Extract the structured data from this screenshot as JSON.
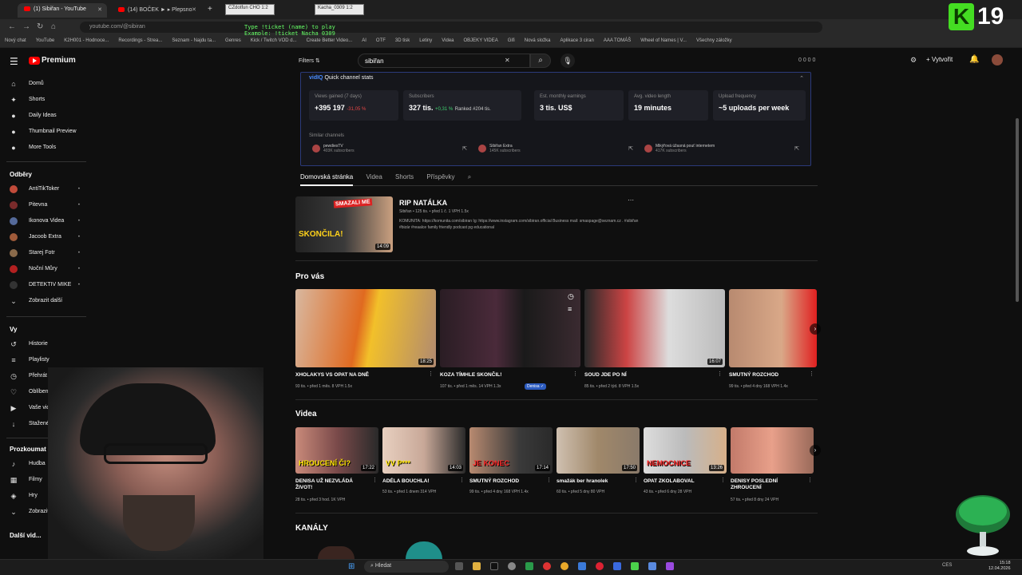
{
  "browser": {
    "tabs": [
      {
        "label": "(1) Sibiřan - YouTube"
      },
      {
        "label": "(14) BOČEK ► ▸ Plepsno"
      }
    ],
    "url": "youtube.com/@sibiran",
    "bookmarks": [
      "Nový chat",
      "YouTube",
      "K2H001 - Hodnoce...",
      "Recordings - Strea...",
      "Seznam - Najdu ta...",
      "Genres",
      "Kick / Twitch VOD d...",
      "Create Better Video...",
      "AI",
      "OTF",
      "3D tisk",
      "Letiny",
      "Videa",
      "OBJEKY VIDEA",
      "Gifi",
      "Nová složka",
      "Aplikace 3 ciran",
      "AAA TOMÁŠ",
      "Wheel of Names | V...",
      "Všechny záložky"
    ],
    "overlay_lines": [
      "Type !ticket (name) to play",
      "Example: !ticket Nacha 0309"
    ],
    "mini_tabs": [
      "CZdotfun CHO 1:2",
      "Kacha_0309 1:2"
    ]
  },
  "brand": {
    "k": "K",
    "num": "19"
  },
  "header": {
    "logo_text": "Premium",
    "filters_label": "Filters",
    "search_value": "sibiřan",
    "create_label": "Vytvořit",
    "counters": "0 0 0 0"
  },
  "sidebar": {
    "main": [
      {
        "label": "Domů",
        "icon": "home-icon",
        "glyph": "⌂"
      },
      {
        "label": "Shorts",
        "icon": "shorts-icon",
        "glyph": "✦"
      },
      {
        "label": "Daily Ideas",
        "icon": "ideas-icon",
        "glyph": "●"
      },
      {
        "label": "Thumbnail Preview",
        "icon": "thumbnail-icon",
        "glyph": "●"
      },
      {
        "label": "More Tools",
        "icon": "tools-icon",
        "glyph": "●"
      }
    ],
    "subs_head": "Odběry",
    "subs": [
      {
        "label": "AntiTikToker",
        "color": "#c14b3a"
      },
      {
        "label": "Pitevna",
        "color": "#7a2b2b"
      },
      {
        "label": "Ikonova Videa",
        "color": "#556a9a"
      },
      {
        "label": "Jacoob Extra",
        "color": "#a05b3a"
      },
      {
        "label": "Starej Fotr",
        "color": "#8a6a4a"
      },
      {
        "label": "Noční Můry",
        "color": "#b32020"
      },
      {
        "label": "DETEKTIV MIKE",
        "color": "#333333"
      }
    ],
    "show_more": "Zobrazit další",
    "you_head": "Vy",
    "you": [
      {
        "label": "Historie",
        "glyph": "↺"
      },
      {
        "label": "Playlisty",
        "glyph": "≡"
      },
      {
        "label": "Přehrát později",
        "glyph": "◷"
      },
      {
        "label": "Oblíbená videa",
        "glyph": "♡"
      },
      {
        "label": "Vaše videa",
        "glyph": "▶"
      },
      {
        "label": "Stažené",
        "glyph": "↓"
      }
    ],
    "explore_head": "Prozkoumat",
    "explore": [
      {
        "label": "Hudba",
        "glyph": "♪"
      },
      {
        "label": "Filmy",
        "glyph": "▦"
      },
      {
        "label": "Hry",
        "glyph": "◈"
      }
    ],
    "explore_more": "Zobrazit další",
    "other_head": "Další vid..."
  },
  "vidiq": {
    "brand": "vidIQ",
    "title": "Quick channel stats",
    "stats": [
      {
        "label": "Views gained (7 days)",
        "value": "+395 197",
        "delta": "-31,05 %",
        "dir": "down"
      },
      {
        "label": "Subscribers",
        "value": "327 tis.",
        "delta": "+0,31 %",
        "dir": "up",
        "rank": "Ranked #204 tis."
      },
      {
        "label": "Est. monthly earnings",
        "value": "3 tis. US$"
      },
      {
        "label": "Avg. video length",
        "value": "19 minutes"
      },
      {
        "label": "Upload frequency",
        "value": "~5 uploads per week"
      }
    ],
    "similar_label": "Similar channels",
    "similar": [
      {
        "name": "pewdiesTV",
        "subs": "403K subscribers"
      },
      {
        "name": "Sibiřan Extra",
        "subs": "145K subscribers"
      },
      {
        "name": "Mikýřová úžasná pouť internetem",
        "subs": "417K subscribers"
      }
    ]
  },
  "channel_tabs": [
    "Domovská stránka",
    "Videa",
    "Shorts",
    "Příspěvky"
  ],
  "featured": {
    "title": "RIP NATÁLKA",
    "meta": "Sibiřan  •  125 tis.  •  před 1 č.  1 VPH  1.5x",
    "desc": "KOMUNITA: https://komunita.com/sibiran Ig: https://www.instagram.com/sibiran.official Business mail: smaspage@seznam.cz . #sibiřan #bizár #reaalce family friendly podcast pg educational",
    "duration": "14:09",
    "thumb_text": [
      "SMAZALI ME",
      "SKONČILA!"
    ]
  },
  "pro_vas": {
    "heading": "Pro vás",
    "videos": [
      {
        "title": "XHOLAKYS VS OPAT NA DNĚ",
        "meta": "93 tis. • před 1 měs.  8 VPH  1.5x",
        "duration": "18:25"
      },
      {
        "title": "KOZA TÍMHLE SKONČIL!",
        "meta": "107 tis. • před 1 měs.  14 VPH  1.3x",
        "badge": "Denisa ✓",
        "duration": ""
      },
      {
        "title": "SOUD JDE PO NÍ",
        "meta": "85 tis. • před 2 týd.  8 VPH  1.5x",
        "duration": "16:07"
      },
      {
        "title": "SMUTNÝ ROZCHOD",
        "meta": "99 tis. • před 4 dny  168 VPH  1.4x",
        "duration": ""
      }
    ]
  },
  "videa": {
    "heading": "Videa",
    "videos": [
      {
        "title": "DENISA UŽ NEZVLÁDÁ ŽIVOT!",
        "meta": "28 tis. • před 3 hod.  1K VPH",
        "duration": "17:22",
        "thumb_text": "HROUCENÍ ČI?"
      },
      {
        "title": "ADÉLA BOUCHLA!",
        "meta": "53 tis. • před 1 dnem  314 VPH",
        "duration": "14:03",
        "thumb_text": "VV P***"
      },
      {
        "title": "SMUTNÝ ROZCHOD",
        "meta": "99 tis. • před 4 dny  168 VPH  1.4x",
        "duration": "17:14",
        "thumb_text": "JE KONEC"
      },
      {
        "title": "smažák ber hranolek",
        "meta": "60 tis. • před 5 dny  80 VPH",
        "duration": "17:50",
        "thumb_text": ""
      },
      {
        "title": "OPAT ZKOLABOVAL",
        "meta": "43 tis. • před 6 dny  28 VPH",
        "duration": "13:26",
        "thumb_text": "NEMOCNICE"
      },
      {
        "title": "DENISY POSLEDNÍ ZHROUCENÍ",
        "meta": "57 tis. • před 8 dny  24 VPH",
        "duration": "",
        "thumb_text": ""
      }
    ]
  },
  "kanaly": {
    "heading": "KANÁLY"
  },
  "taskbar": {
    "search": "Hledat",
    "tray": "CES",
    "time": "15:18",
    "date": "12.04.2026"
  }
}
